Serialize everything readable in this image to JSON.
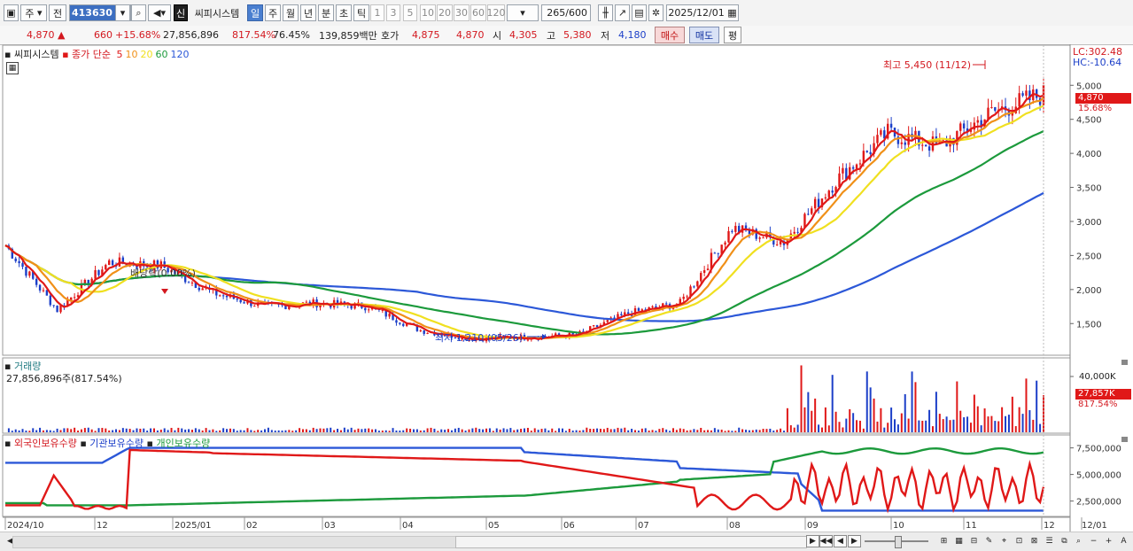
{
  "toolbar": {
    "market": "주",
    "prev_label": "전",
    "stock_code": "413630",
    "credit_label": "신",
    "stock_name": "씨피시스템",
    "periods": [
      "일",
      "주",
      "월",
      "년",
      "분",
      "초",
      "틱"
    ],
    "selected_period": "일",
    "intervals": [
      "1",
      "3",
      "5",
      "10",
      "20",
      "30",
      "60",
      "120"
    ],
    "count": "265",
    "count_total": "/600",
    "date": "2025/12/01"
  },
  "infobar": {
    "price": "4,870",
    "direction": "▲",
    "change": "660",
    "change_pct": "+15.68%",
    "volume": "27,856,896",
    "volume_ratio": "817.54%",
    "turnover": "76.45%",
    "amount": "139,859백만",
    "bid_label": "호가",
    "bid": "4,875",
    "bid2": "4,870",
    "open_label": "시",
    "open": "4,305",
    "high_label": "고",
    "high": "5,380",
    "low_label": "저",
    "low": "4,180",
    "buy_label": "매수",
    "sell_label": "매도",
    "eval_label": "평"
  },
  "price_panel": {
    "name": "씨피시스템",
    "ma_label": "종가 단순",
    "ma_periods": [
      "5",
      "10",
      "20",
      "60",
      "120"
    ],
    "ma_colors": [
      "#e01818",
      "#f09018",
      "#f0e020",
      "#1c9a3c",
      "#2c58d8"
    ],
    "lc_label": "LC:302.48",
    "hc_label": "HC:-10.64",
    "high_annotation": "최고 5,450 (11/12)",
    "low_annotation": "최저 1,210 (05/26)",
    "dividend_annotation": "배당락(0.00%)",
    "price_tag": "4,870",
    "pct_tag": "15.68%",
    "y_ticks": [
      "5,000",
      "4,500",
      "4,000",
      "3,500",
      "3,000",
      "2,500",
      "2,000",
      "1,500"
    ]
  },
  "volume_panel": {
    "title": "거래량",
    "value_text": "27,856,896주(817.54%)",
    "y_tick": "40,000K",
    "tag": "27,857K",
    "pct_tag": "817.54%"
  },
  "holding_panel": {
    "foreign_label": "외국인보유수량",
    "inst_label": "기관보유수량",
    "indiv_label": "개인보유수량",
    "y_ticks": [
      "7,500,000",
      "5,000,000",
      "2,500,000"
    ]
  },
  "x_axis": [
    "2024/10",
    "12",
    "2025/01",
    "02",
    "03",
    "04",
    "05",
    "06",
    "07",
    "08",
    "09",
    "10",
    "11",
    "12",
    "12/01"
  ],
  "colors": {
    "up": "#e01818",
    "down": "#1c3fc8",
    "ma5": "#e01818",
    "ma10": "#f09018",
    "ma20": "#f0e020",
    "ma60": "#1c9a3c",
    "ma120": "#2c58d8"
  },
  "chart_data": {
    "type": "candlestick",
    "title": "씨피시스템",
    "y_range": [
      1210,
      5450
    ],
    "points": [
      [
        "2024/10",
        2650
      ],
      [
        "2024/11",
        1700
      ],
      [
        "2024/11",
        2400
      ],
      [
        "2024/12",
        2350
      ],
      [
        "2024/12",
        1950
      ],
      [
        "2025/01",
        1750
      ],
      [
        "2025/02",
        1800
      ],
      [
        "2025/03",
        1750
      ],
      [
        "2025/04",
        1400
      ],
      [
        "2025/05",
        1280
      ],
      [
        "2025/06",
        1300
      ],
      [
        "2025/07",
        1330
      ],
      [
        "2025/08",
        1650
      ],
      [
        "2025/09",
        1800
      ],
      [
        "2025/09",
        2900
      ],
      [
        "2025/10",
        2700
      ],
      [
        "2025/10",
        3600
      ],
      [
        "2025/11",
        4300
      ],
      [
        "2025/11",
        4100
      ],
      [
        "2025/11",
        4600
      ],
      [
        "2025/12",
        4870
      ]
    ],
    "high": {
      "value": 5450,
      "date": "11/12"
    },
    "low": {
      "value": 1210,
      "date": "05/26"
    }
  }
}
